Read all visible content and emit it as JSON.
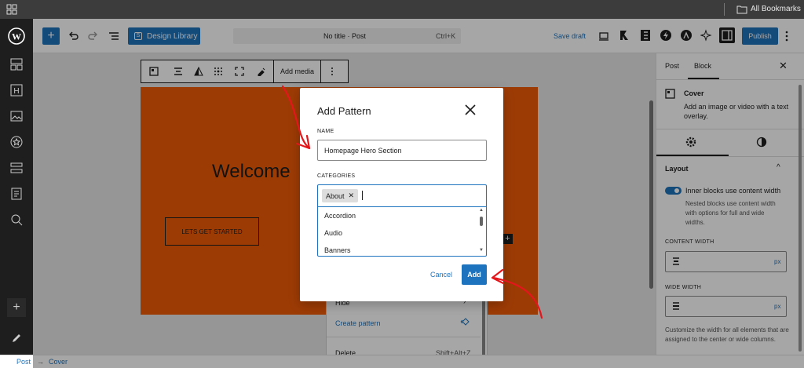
{
  "browser": {
    "bookmarks_label": "All Bookmarks"
  },
  "toolbar": {
    "design_library_label": "Design Library",
    "doc_title": "No title · Post",
    "shortcut": "Ctrl+K",
    "save_draft_label": "Save draft",
    "publish_label": "Publish"
  },
  "block_toolbar": {
    "add_media_label": "Add media"
  },
  "cover": {
    "heading": "Welcome",
    "button_label": "LETS GET STARTED",
    "color": "#f25b09"
  },
  "context_menu": {
    "hide_label": "Hide",
    "create_pattern_label": "Create pattern",
    "delete_label": "Delete",
    "delete_shortcut": "Shift+Alt+Z"
  },
  "modal": {
    "title": "Add Pattern",
    "name_label": "NAME",
    "name_value": "Homepage Hero Section",
    "categories_label": "CATEGORIES",
    "selected_tag": "About",
    "options": [
      "Accordion",
      "Audio",
      "Banners"
    ],
    "cancel_label": "Cancel",
    "add_label": "Add"
  },
  "sidebar": {
    "tab_post": "Post",
    "tab_block": "Block",
    "block_name": "Cover",
    "block_desc": "Add an image or video with a text overlay.",
    "layout_title": "Layout",
    "toggle_label": "Inner blocks use content width",
    "toggle_help": "Nested blocks use content width with options for full and wide widths.",
    "content_width_label": "CONTENT WIDTH",
    "wide_width_label": "WIDE WIDTH",
    "unit": "px",
    "width_help": "Customize the width for all elements that are assigned to the center or wide columns."
  },
  "breadcrumb": {
    "item1": "Post",
    "sep": "→",
    "item2": "Cover"
  },
  "colors": {
    "accent": "#1e73be",
    "annotation_red": "#e3161b",
    "dark_rail": "#1e1e1e"
  }
}
